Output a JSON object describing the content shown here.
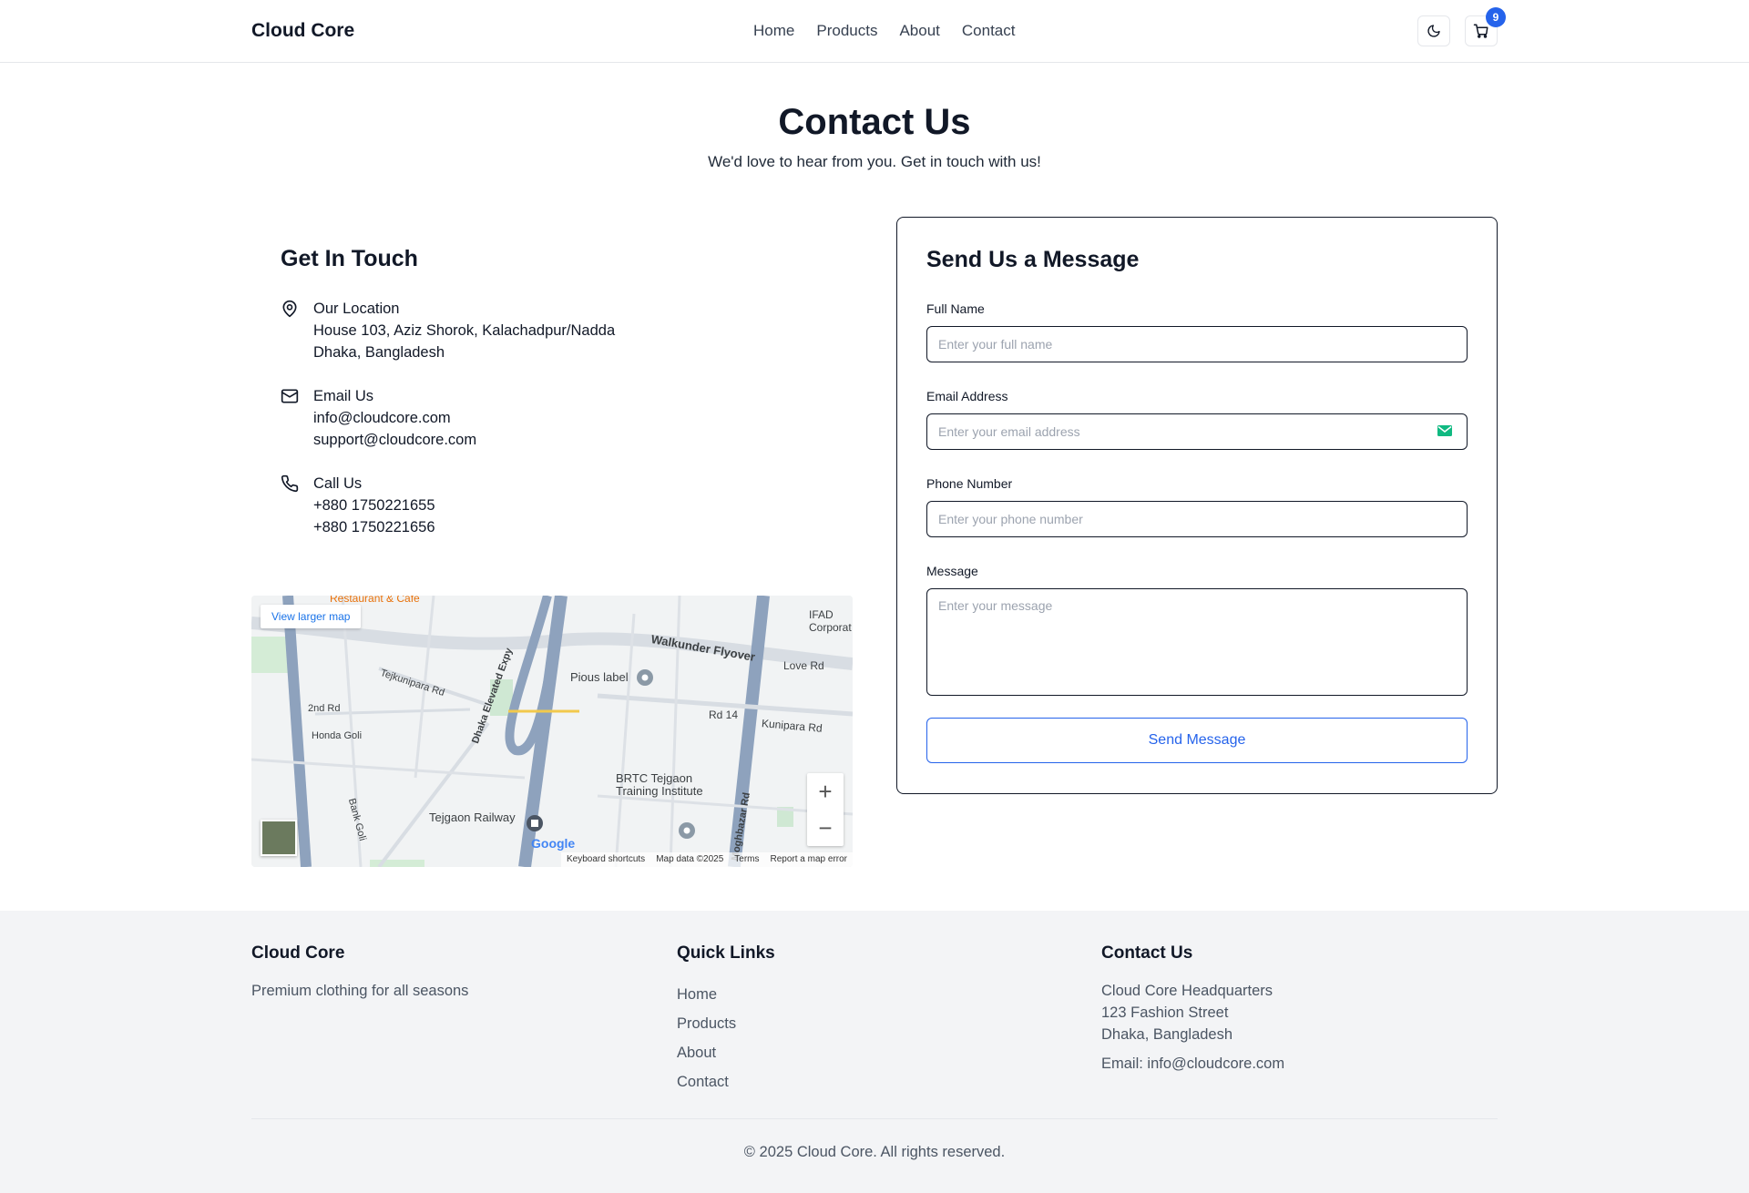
{
  "header": {
    "brand": "Cloud Core",
    "nav": [
      "Home",
      "Products",
      "About",
      "Contact"
    ],
    "cart_count": "9"
  },
  "hero": {
    "title": "Contact Us",
    "subtitle": "We'd love to hear from you. Get in touch with us!"
  },
  "touch": {
    "title": "Get In Touch",
    "location": {
      "heading": "Our Location",
      "line1": "House 103, Aziz Shorok, Kalachadpur/Nadda",
      "line2": "Dhaka, Bangladesh",
      "icon": "map-pin-icon"
    },
    "email": {
      "heading": "Email Us",
      "line1": "info@cloudcore.com",
      "line2": "support@cloudcore.com",
      "icon": "mail-icon"
    },
    "phone": {
      "heading": "Call Us",
      "line1": "+880 1750221655",
      "line2": "+880 1750221656",
      "icon": "phone-icon"
    }
  },
  "map": {
    "view_larger": "View larger map",
    "labels": [
      "Walkunder Flyover",
      "Pious label",
      "Tejkunipara Rd",
      "Dhaka Elevated Expy",
      "Rd 14",
      "Kunipara Rd",
      "Love Rd",
      "2nd Rd",
      "Honda Goli",
      "BRTC Tejgaon Training Institute",
      "Tejgaon Railway",
      "Moghbazar Rd",
      "IFAD Corporat",
      "Bank Goli",
      "Restaurant & Cafe"
    ],
    "footer": [
      "Keyboard shortcuts",
      "Map data ©2025",
      "Terms",
      "Report a map error"
    ],
    "google": "Google"
  },
  "form": {
    "title": "Send Us a Message",
    "name_label": "Full Name",
    "name_placeholder": "Enter your full name",
    "email_label": "Email Address",
    "email_placeholder": "Enter your email address",
    "phone_label": "Phone Number",
    "phone_placeholder": "Enter your phone number",
    "message_label": "Message",
    "message_placeholder": "Enter your message",
    "submit": "Send Message"
  },
  "footer": {
    "brand": "Cloud Core",
    "tagline": "Premium clothing for all seasons",
    "links_title": "Quick Links",
    "links": [
      "Home",
      "Products",
      "About",
      "Contact"
    ],
    "contact_title": "Contact Us",
    "address1": "Cloud Core Headquarters",
    "address2": "123 Fashion Street",
    "address3": "Dhaka, Bangladesh",
    "email": "Email: info@cloudcore.com",
    "copyright": "© 2025 Cloud Core. All rights reserved."
  },
  "colors": {
    "accent": "#2563eb",
    "text": "#111827",
    "footer_bg": "#f3f4f6"
  }
}
